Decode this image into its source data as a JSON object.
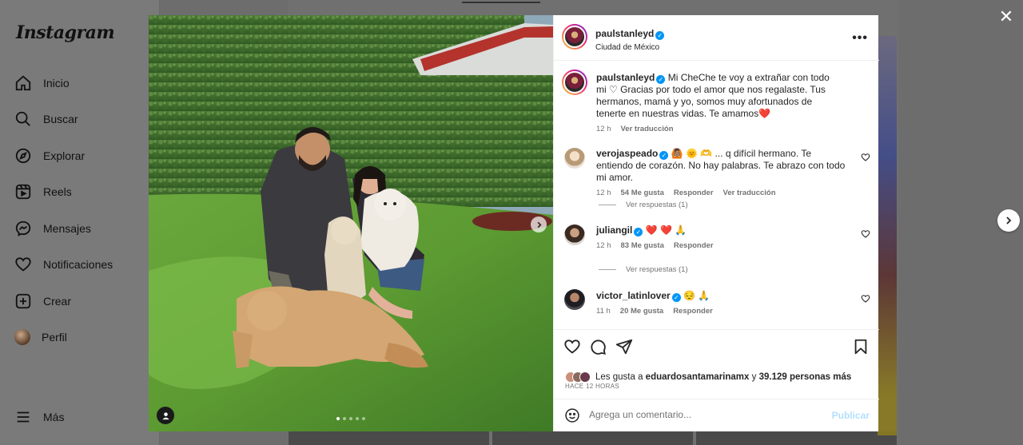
{
  "app": {
    "logo": "Instagram"
  },
  "sidebar": {
    "items": [
      {
        "label": "Inicio",
        "icon": "home-icon"
      },
      {
        "label": "Buscar",
        "icon": "search-icon"
      },
      {
        "label": "Explorar",
        "icon": "compass-icon"
      },
      {
        "label": "Reels",
        "icon": "reels-icon"
      },
      {
        "label": "Mensajes",
        "icon": "messenger-icon"
      },
      {
        "label": "Notificaciones",
        "icon": "heart-icon"
      },
      {
        "label": "Crear",
        "icon": "plus-square-icon"
      },
      {
        "label": "Perfil",
        "icon": "avatar"
      }
    ],
    "more": "Más"
  },
  "post": {
    "username": "paulstanleyd",
    "location": "Ciudad de México",
    "caption": {
      "username": "paulstanleyd",
      "text": "Mi CheChe te voy a extrañar con todo mi ♡ Gracias por todo el amor que nos regalaste. Tus hermanos, mamá y yo, somos muy afortunados de tenerte en nuestras vidas. Te amamos",
      "emoji": "❤️",
      "time": "12 h",
      "translate": "Ver traducción"
    },
    "comments": [
      {
        "username": "verojaspeado",
        "text": "🙆🏽 🌞 🫶 ... q difícil hermano. Te entiendo de corazón. No hay palabras. Te abrazo con todo mi amor.",
        "time": "12 h",
        "likes": "54 Me gusta",
        "reply": "Responder",
        "translate": "Ver traducción",
        "replies": "Ver respuestas (1)"
      },
      {
        "username": "juliangil",
        "text": "❤️ ❤️ 🙏",
        "time": "12 h",
        "likes": "83 Me gusta",
        "reply": "Responder",
        "replies": "Ver respuestas (1)"
      },
      {
        "username": "victor_latinlover",
        "text": "😔 🙏",
        "time": "11 h",
        "likes": "20 Me gusta",
        "reply": "Responder"
      }
    ],
    "likes_prefix": "Les gusta a",
    "likes_user": "eduardosantamarinamx",
    "likes_mid": "y",
    "likes_count": "39.129 personas más",
    "time_ago": "HACE 12 HORAS",
    "comment_placeholder": "Agrega un comentario...",
    "publish": "Publicar",
    "carousel": {
      "slides": 5,
      "active_index": 0
    }
  },
  "colors": {
    "verified": "#0095f6",
    "publish_disabled": "#b2dffc",
    "heart_red": "#ed4956"
  }
}
